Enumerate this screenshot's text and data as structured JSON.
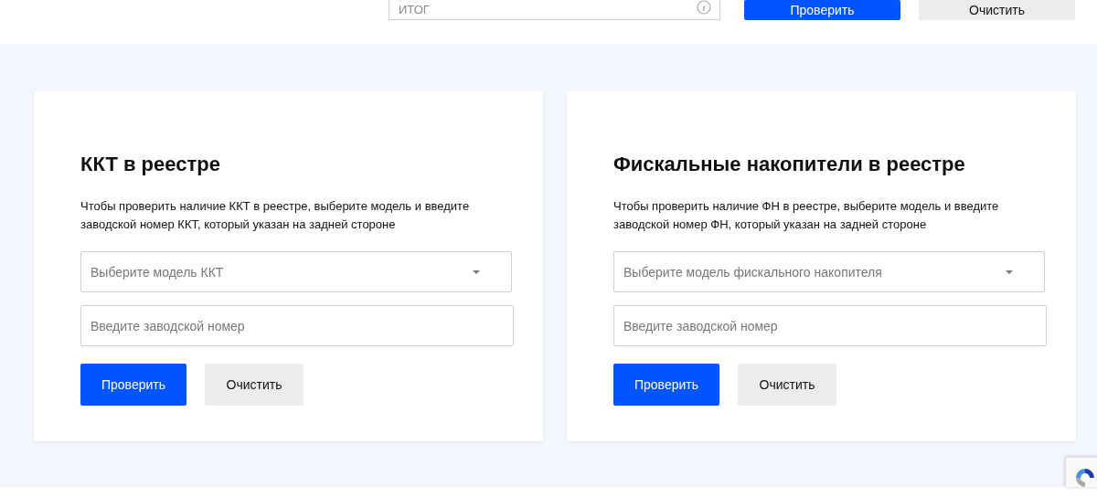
{
  "top_bar": {
    "field": {
      "placeholder": "ИТОГ"
    },
    "buttons": [
      {
        "label": "Проверить",
        "kind": "primary"
      },
      {
        "label": "Очистить",
        "kind": "secondary"
      }
    ]
  },
  "cards": [
    {
      "title": "ККТ в реестре",
      "description": "Чтобы проверить наличие ККТ в реестре, выберите модель и введите заводской номер ККТ, который указан на задней стороне",
      "select": {
        "placeholder": "Выберите модель ККТ"
      },
      "input": {
        "placeholder": "Введите заводской номер"
      },
      "buttons": [
        {
          "label": "Проверить",
          "kind": "primary"
        },
        {
          "label": "Очистить",
          "kind": "secondary"
        }
      ]
    },
    {
      "title": "Фискальные накопители в реестре",
      "description": "Чтобы проверить наличие ФН в реестре, выберите модель и введите заводской номер ФН, который указан на задней стороне",
      "select": {
        "placeholder": "Выберите модель фискального накопителя"
      },
      "input": {
        "placeholder": "Введите заводской номер"
      },
      "buttons": [
        {
          "label": "Проверить",
          "kind": "primary"
        },
        {
          "label": "Очистить",
          "kind": "secondary"
        }
      ]
    }
  ]
}
